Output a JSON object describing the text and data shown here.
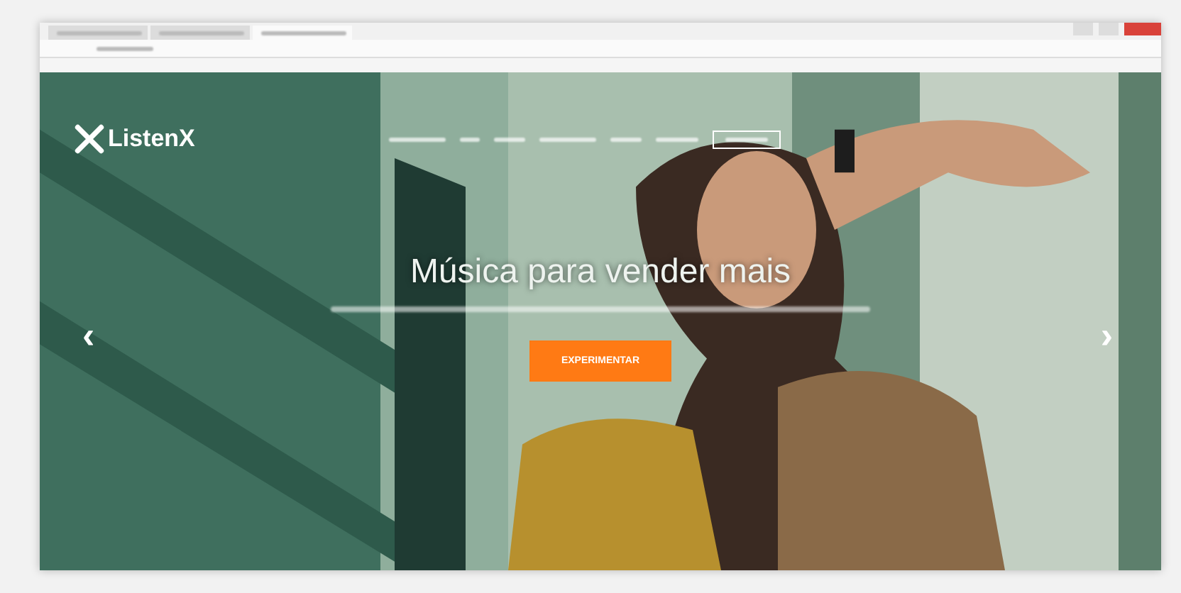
{
  "browser": {
    "tabs": [
      {
        "selected": false
      },
      {
        "selected": false
      },
      {
        "selected": true
      }
    ]
  },
  "hero": {
    "logo": "ListenX",
    "headline": "Música para vender mais",
    "cta": "EXPERIMENTAR",
    "prev": "‹",
    "next": "›"
  }
}
